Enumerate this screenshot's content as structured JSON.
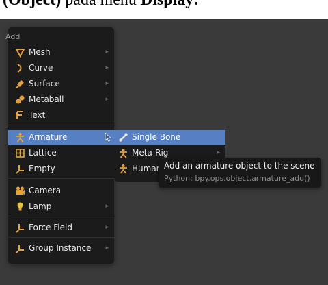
{
  "caption": {
    "prefix": "(Object)",
    "middle": " pada menu ",
    "suffix": "Display:"
  },
  "menu": {
    "title": "Add",
    "items": [
      {
        "label": "Mesh",
        "icon": "mesh-icon",
        "has_submenu": true
      },
      {
        "label": "Curve",
        "icon": "curve-icon",
        "has_submenu": true
      },
      {
        "label": "Surface",
        "icon": "surface-icon",
        "has_submenu": true
      },
      {
        "label": "Metaball",
        "icon": "metaball-icon",
        "has_submenu": true
      },
      {
        "label": "Text",
        "icon": "text-icon",
        "has_submenu": false
      },
      {
        "label": "Armature",
        "icon": "armature-icon",
        "has_submenu": true,
        "active": true
      },
      {
        "label": "Lattice",
        "icon": "lattice-icon",
        "has_submenu": false
      },
      {
        "label": "Empty",
        "icon": "empty-icon",
        "has_submenu": true
      },
      {
        "label": "Camera",
        "icon": "camera-icon",
        "has_submenu": false
      },
      {
        "label": "Lamp",
        "icon": "lamp-icon",
        "has_submenu": true
      },
      {
        "label": "Force Field",
        "icon": "force-field-icon",
        "has_submenu": true
      },
      {
        "label": "Group Instance",
        "icon": "group-instance-icon",
        "has_submenu": true
      }
    ]
  },
  "submenu": {
    "items": [
      {
        "label": "Single Bone",
        "icon": "bone-icon",
        "active": true
      },
      {
        "label": "Meta-Rig",
        "icon": "armature-icon",
        "has_submenu": true
      },
      {
        "label": "Human",
        "icon": "armature-icon"
      }
    ]
  },
  "tooltip": {
    "description": "Add an armature object to the scene",
    "python": "Python: bpy.ops.object.armature_add()"
  },
  "colors": {
    "menu_bg": "#1b1b1b",
    "highlight": "#5680c2",
    "viewport_bg": "#3a3a3a",
    "icon_orange": "#e8a23a"
  }
}
